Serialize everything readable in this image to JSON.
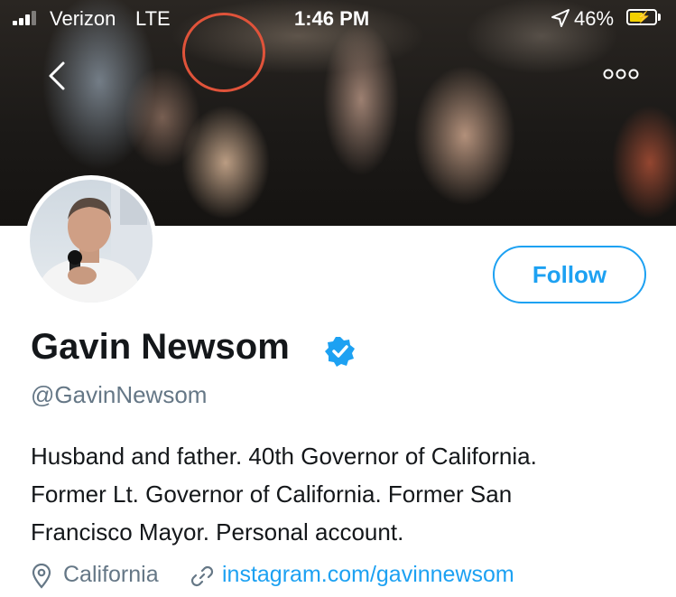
{
  "status_bar": {
    "carrier": "Verizon",
    "network": "LTE",
    "time": "1:46 PM",
    "battery_percent": "46%",
    "battery_level": 0.46,
    "battery_charging": true
  },
  "header": {
    "back_icon": "chevron-left-icon",
    "more_icon": "more-horizontal-icon"
  },
  "profile": {
    "name": "Gavin Newsom",
    "verified": true,
    "handle": "@GavinNewsom",
    "follow_label": "Follow",
    "bio_lines": [
      "Husband and father. 40th Governor of California.",
      "Former Lt. Governor of California. Former San",
      "Francisco Mayor. Personal account."
    ],
    "location": "California",
    "website": "instagram.com/gavinnewsom"
  },
  "colors": {
    "accent": "#1da1f2",
    "secondary_text": "#657786",
    "primary_text": "#14171a",
    "annotation_circle": "#e0533a"
  }
}
